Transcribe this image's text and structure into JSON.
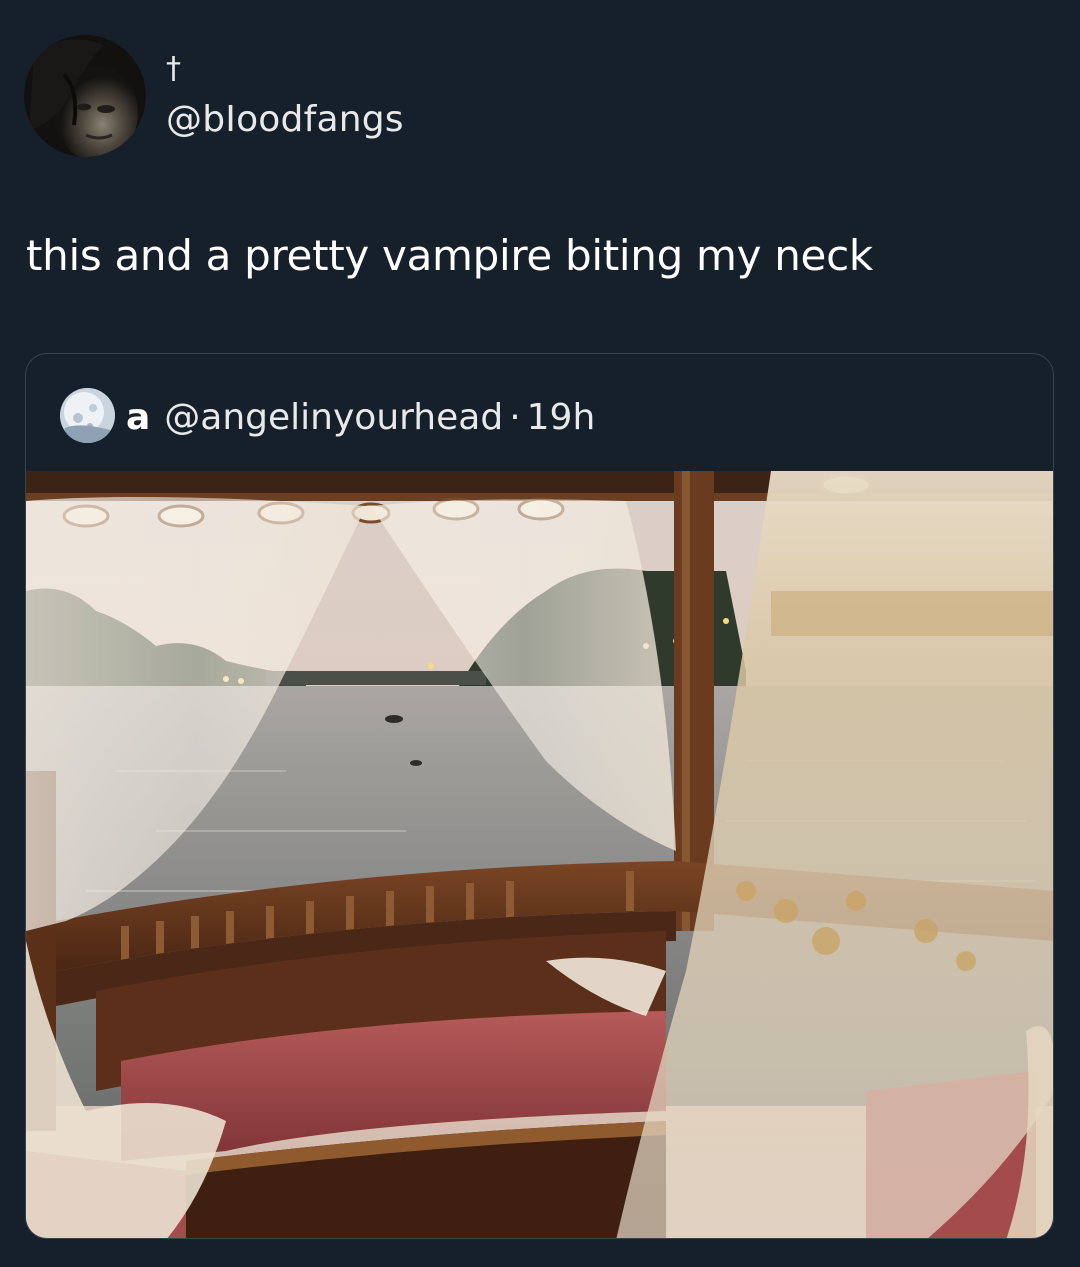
{
  "tweet": {
    "author": {
      "display_name": "†",
      "handle": "@bIoodfangs",
      "avatar_icon": "profile-photo"
    },
    "text": "this and a pretty vampire biting my neck"
  },
  "quoted_tweet": {
    "author": {
      "display_name": "a",
      "handle": "@angelinyourhead",
      "avatar_icon": "moon-profile-photo"
    },
    "separator": "·",
    "time": "19h",
    "media": {
      "type": "photo",
      "icon": "boat-with-curtains-on-river-photo"
    }
  },
  "colors": {
    "background": "#15202b",
    "text": "#e7e9ea",
    "card_border": "#38444d"
  }
}
